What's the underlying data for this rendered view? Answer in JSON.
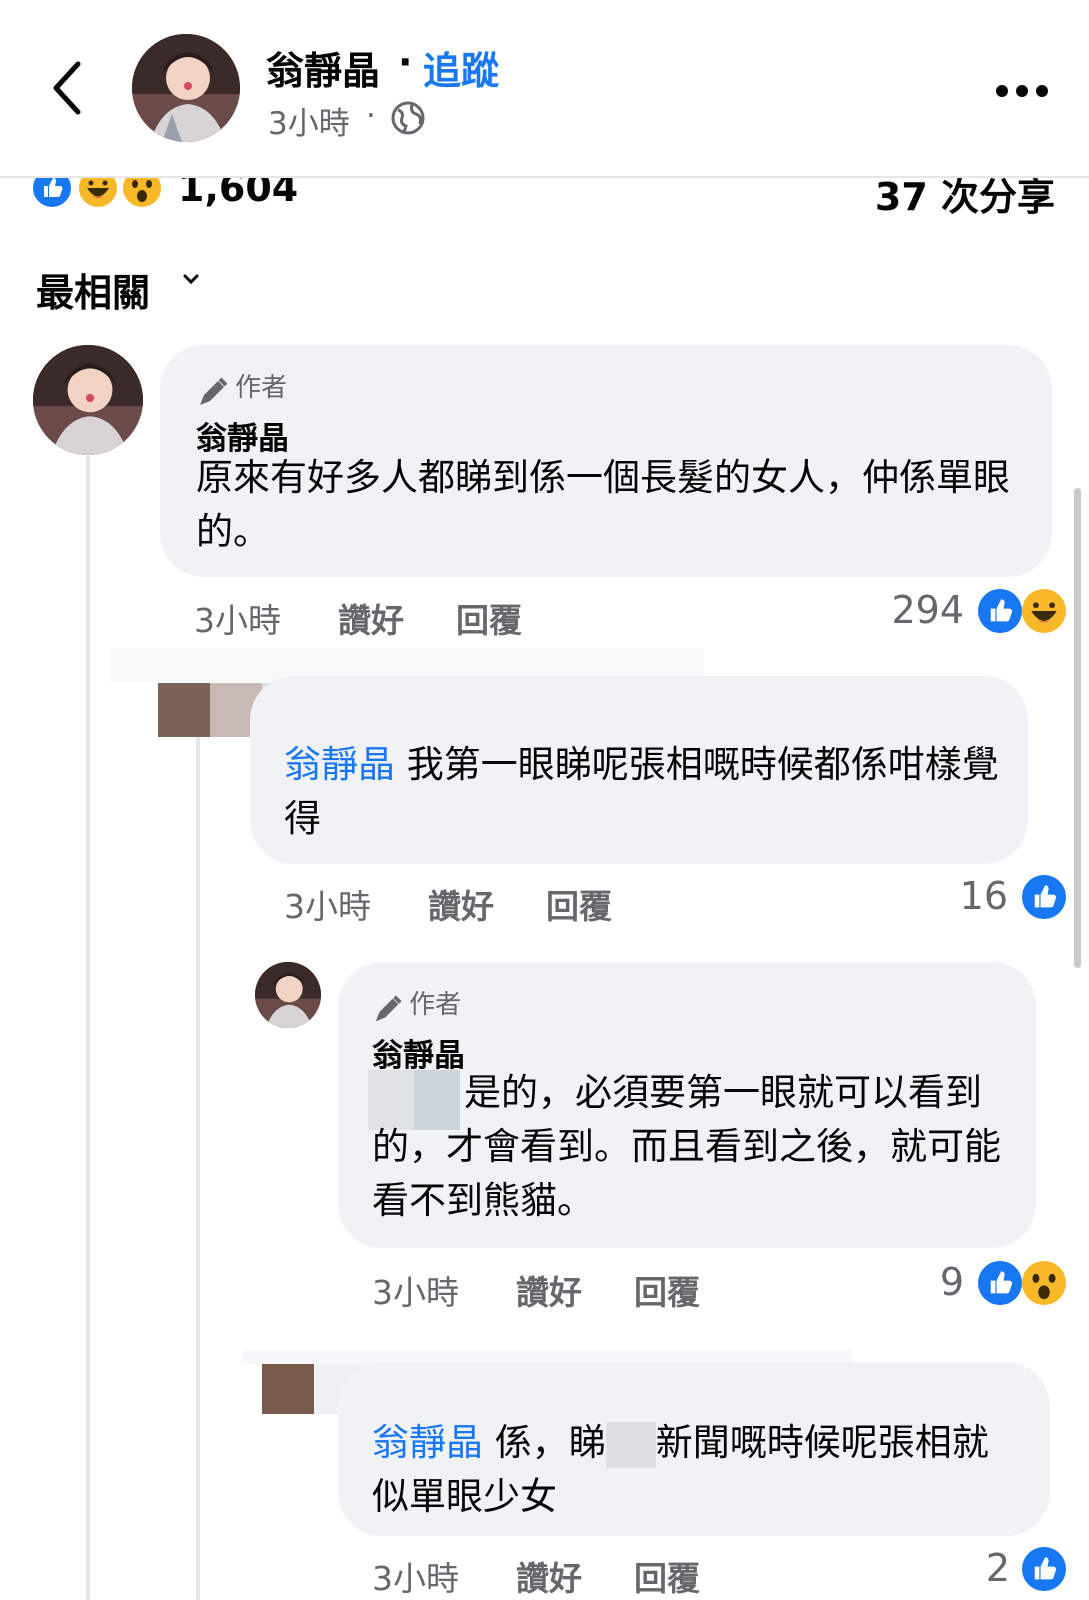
{
  "header": {
    "author_name": "翁靜晶",
    "separator": "·",
    "follow_label": "追蹤",
    "time": "3小時",
    "time_separator": "·",
    "privacy_icon": "globe-icon",
    "more_icon": "more-horizontal-icon",
    "back_icon": "chevron-left-icon"
  },
  "reactions": {
    "icons": [
      "like-icon",
      "haha-icon",
      "wow-icon"
    ],
    "total": "1,604",
    "shares": "37 次分享"
  },
  "sort": {
    "label": "最相關",
    "icon": "chevron-down-icon"
  },
  "comments": [
    {
      "author_badge": "作者",
      "name": "翁靜晶",
      "text": "原來有好多人都睇到係一個長髮的女人，仲係單眼的。",
      "time": "3小時",
      "like_label": "讚好",
      "reply_label": "回覆",
      "count": "294",
      "reaction_icons": [
        "like-icon",
        "haha-icon"
      ]
    },
    {
      "mention": "翁靜晶",
      "text": "我第一眼睇呢張相嘅時候都係咁樣覺得",
      "time": "3小時",
      "like_label": "讚好",
      "reply_label": "回覆",
      "count": "16",
      "reaction_icons": [
        "like-icon"
      ]
    },
    {
      "author_badge": "作者",
      "name": "翁靜晶",
      "text": "是的，必須要第一眼就可以看到的，才會看到。而且看到之後，就可能看不到熊貓。",
      "time": "3小時",
      "like_label": "讚好",
      "reply_label": "回覆",
      "count": "9",
      "reaction_icons": [
        "like-icon",
        "wow-icon"
      ]
    },
    {
      "mention": "翁靜晶",
      "text_a": "係，睇",
      "text_b": "新聞嘅時候呢張相就似單眼少女",
      "time": "3小時",
      "like_label": "讚好",
      "reply_label": "回覆",
      "count": "2",
      "reaction_icons": [
        "like-icon"
      ]
    }
  ],
  "colors": {
    "accent": "#1877f2",
    "bubble": "#f0f2f5",
    "secondary_text": "#65676b",
    "haha_yellow": "#f7b928"
  }
}
